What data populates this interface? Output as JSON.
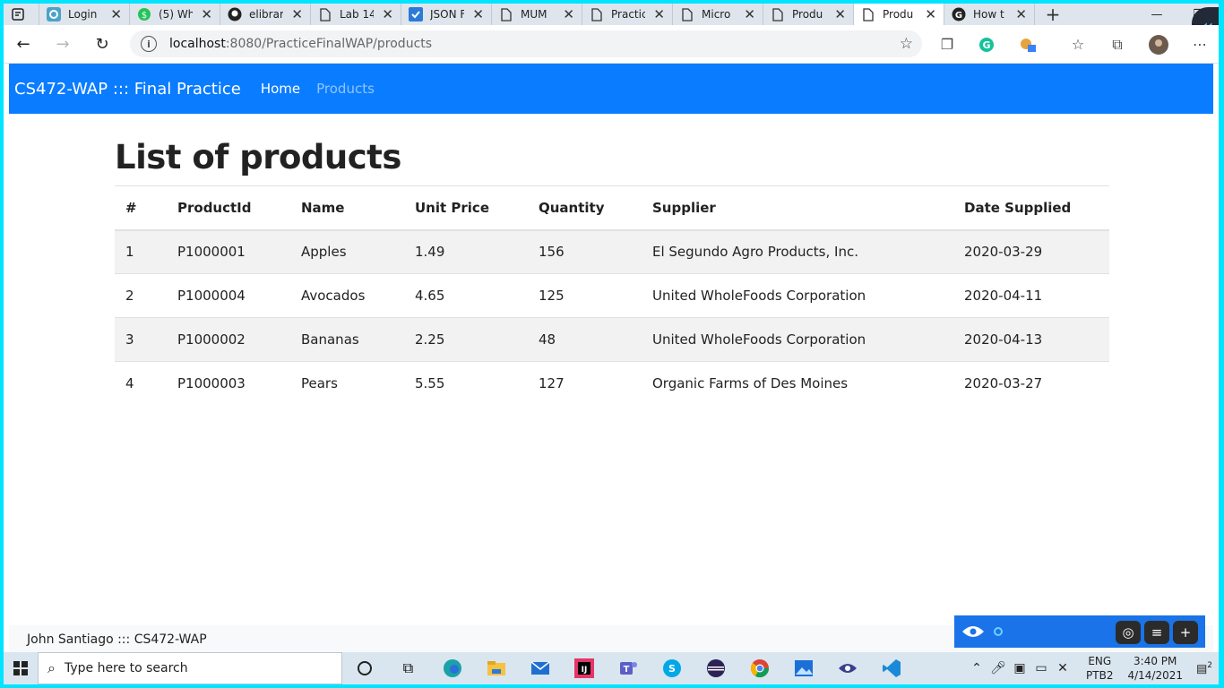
{
  "browser": {
    "tabs": [
      {
        "label": "",
        "icon": "edge-tab-actions-icon"
      },
      {
        "label": "Login",
        "icon": "q-app-icon"
      },
      {
        "label": "(5) Wh",
        "icon": "whatsapp-icon"
      },
      {
        "label": "elibrar",
        "icon": "github-icon"
      },
      {
        "label": "Lab 14",
        "icon": "page-icon"
      },
      {
        "label": "JSON F",
        "icon": "check-icon"
      },
      {
        "label": "MUM",
        "icon": "page-icon"
      },
      {
        "label": "Practic",
        "icon": "page-icon"
      },
      {
        "label": "Micro",
        "icon": "page-icon"
      },
      {
        "label": "Produ",
        "icon": "page-icon"
      },
      {
        "label": "Produ",
        "icon": "page-icon",
        "active": true
      },
      {
        "label": "How t",
        "icon": "google-icon"
      }
    ],
    "url_host": "localhost",
    "url_rest": ":8080/PracticeFinalWAP/products"
  },
  "navbar": {
    "brand": "CS472-WAP ::: Final Practice",
    "links": [
      "Home",
      "Products"
    ]
  },
  "main": {
    "heading": "List of products",
    "table": {
      "headers": [
        "#",
        "ProductId",
        "Name",
        "Unit Price",
        "Quantity",
        "Supplier",
        "Date Supplied"
      ],
      "rows": [
        [
          "1",
          "P1000001",
          "Apples",
          "1.49",
          "156",
          "El Segundo Agro Products, Inc.",
          "2020-03-29"
        ],
        [
          "2",
          "P1000004",
          "Avocados",
          "4.65",
          "125",
          "United WholeFoods Corporation",
          "2020-04-11"
        ],
        [
          "3",
          "P1000002",
          "Bananas",
          "2.25",
          "48",
          "United WholeFoods Corporation",
          "2020-04-13"
        ],
        [
          "4",
          "P1000003",
          "Pears",
          "5.55",
          "127",
          "Organic Farms of Des Moines",
          "2020-03-27"
        ]
      ]
    }
  },
  "footer": {
    "text": "John Santiago ::: CS472-WAP"
  },
  "taskbar": {
    "search_placeholder": "Type here to search",
    "lang_top": "ENG",
    "lang_bottom": "PTB2",
    "time": "3:40 PM",
    "date": "4/14/2021",
    "notifications": "2"
  },
  "colors": {
    "navbar": "#0a7cff",
    "frame": "#00e5ff"
  }
}
